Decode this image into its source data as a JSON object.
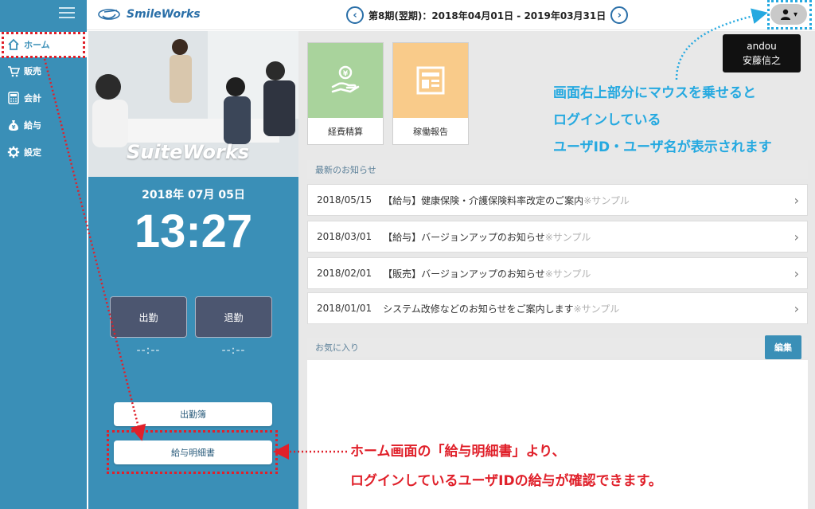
{
  "header": {
    "logo": "SmileWorks",
    "period": "第8期(翌期)：2018年04月01日 - 2019年03月31日",
    "prev": "‹",
    "next": "›",
    "user_caret": "▾"
  },
  "sidebar": {
    "items": [
      {
        "label": "ホーム",
        "icon": "home-icon"
      },
      {
        "label": "販売",
        "icon": "cart-icon"
      },
      {
        "label": "会計",
        "icon": "calculator-icon"
      },
      {
        "label": "給与",
        "icon": "money-bag-icon"
      },
      {
        "label": "設定",
        "icon": "gear-icon"
      }
    ]
  },
  "left_panel": {
    "photo_logo": "SuiteWorks",
    "date": "2018年 07月 05日",
    "time": "13:27",
    "clock_in": "出勤",
    "clock_out": "退勤",
    "clock_in_time": "--:--",
    "clock_out_time": "--:--",
    "attendance_book": "出勤簿",
    "payslip": "給与明細書"
  },
  "main": {
    "tiles": [
      {
        "label": "経費精算",
        "color": "#a9d39c"
      },
      {
        "label": "稼働報告",
        "color": "#f9cb8a"
      }
    ],
    "news_header": "最新のお知らせ",
    "news": [
      {
        "date": "2018/05/15",
        "text": "【給与】健康保険・介護保険料率改定のご案内",
        "sample": "※サンプル"
      },
      {
        "date": "2018/03/01",
        "text": "【給与】バージョンアップのお知らせ",
        "sample": "※サンプル"
      },
      {
        "date": "2018/02/01",
        "text": "【販売】バージョンアップのお知らせ",
        "sample": "※サンプル"
      },
      {
        "date": "2018/01/01",
        "text": "システム改修などのお知らせをご案内します",
        "sample": "※サンプル"
      }
    ],
    "favorites_header": "お気に入り",
    "edit_button": "編集"
  },
  "tooltip": {
    "user_id": "andou",
    "user_name": "安藤信之"
  },
  "annotations": {
    "blue": [
      "画面右上部分にマウスを乗せると",
      "ログインしている",
      "ユーザID・ユーザ名が表示されます"
    ],
    "red": [
      "ホーム画面の「給与明細書」より、",
      "ログインしているユーザIDの給与が確認できます。"
    ]
  },
  "colors": {
    "brand": "#3a8fb7",
    "accent_red": "#e0202a",
    "accent_blue": "#25a9e0"
  }
}
